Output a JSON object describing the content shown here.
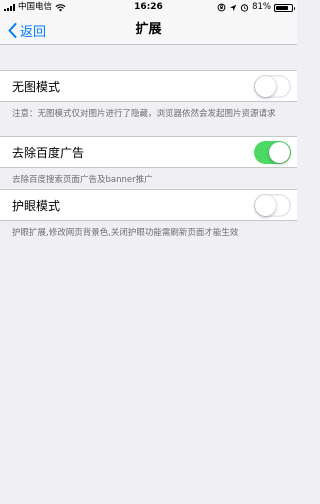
{
  "status_bar": {
    "carrier": "中国电信",
    "time": "16:26",
    "battery_percent": "81%",
    "battery_level": 0.81
  },
  "nav": {
    "back_label": "返回",
    "title": "扩展"
  },
  "settings": [
    {
      "label": "无图模式",
      "enabled": false,
      "note": "注意：无图模式仅对图片进行了隐藏，浏览器依然会发起图片资源请求"
    },
    {
      "label": "去除百度广告",
      "enabled": true,
      "note": "去除百度搜索页面广告及banner推广"
    },
    {
      "label": "护眼模式",
      "enabled": false,
      "note": "护眼扩展,修改网页背景色,关闭护眼功能需刷新页面才能生效"
    }
  ],
  "colors": {
    "accent": "#007aff",
    "toggle_on": "#4cd964",
    "background": "#efeff4"
  }
}
